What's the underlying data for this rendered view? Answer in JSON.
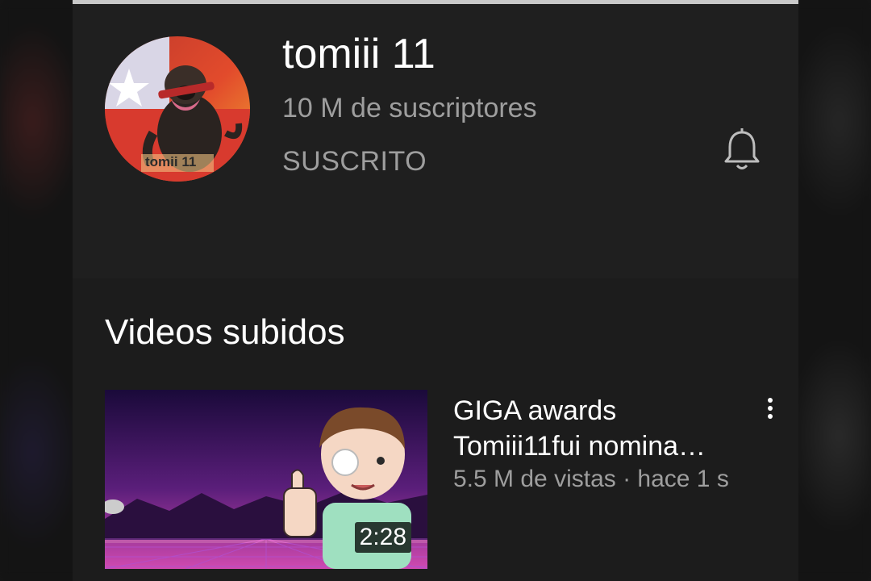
{
  "channel": {
    "name": "tomiii 11",
    "subscribers": "10 M de suscriptores",
    "subscribe_state": "SUSCRITO",
    "avatar_text": "tomii 11",
    "notification_icon": "bell-icon"
  },
  "section": {
    "title": "Videos subidos"
  },
  "videos": [
    {
      "title_line1": "GIGA awards",
      "title_line2": "Tomiii11fui nomina…",
      "meta": "5.5 M de vistas · hace 1 s",
      "duration": "2:28",
      "menu_icon": "more-vert-icon"
    }
  ],
  "colors": {
    "background": "#1f1f1f",
    "primary_text": "#ffffff",
    "secondary_text": "#9e9e9e"
  }
}
